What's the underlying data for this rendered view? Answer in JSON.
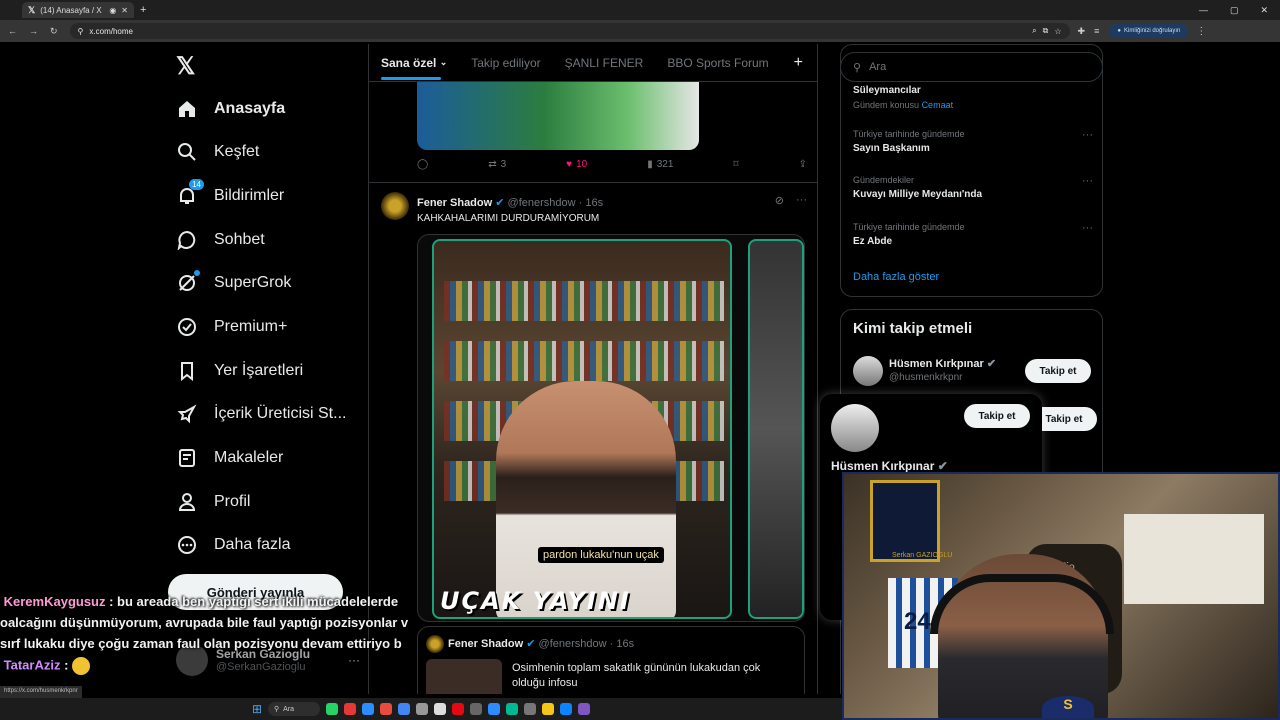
{
  "browser": {
    "tab_title": "(14) Anasayfa / X",
    "url": "x.com/home",
    "verify_label": "Kimliğinizi doğrulayın",
    "status_url": "https://x.com/husmenkrkpnr"
  },
  "sidebar": {
    "items": [
      {
        "label": "Anasayfa",
        "icon": "home-icon"
      },
      {
        "label": "Keşfet",
        "icon": "search-icon"
      },
      {
        "label": "Bildirimler",
        "icon": "bell-icon",
        "badge": "14"
      },
      {
        "label": "Sohbet",
        "icon": "chat-icon"
      },
      {
        "label": "SuperGrok",
        "icon": "grok-icon"
      },
      {
        "label": "Premium+",
        "icon": "verified-icon"
      },
      {
        "label": "Yer İşaretleri",
        "icon": "bookmark-icon"
      },
      {
        "label": "İçerik Üreticisi St...",
        "icon": "rocket-icon"
      },
      {
        "label": "Makaleler",
        "icon": "article-icon"
      },
      {
        "label": "Profil",
        "icon": "person-icon"
      },
      {
        "label": "Daha fazla",
        "icon": "more-icon"
      }
    ],
    "post_button": "Gönderi yayınla",
    "account": {
      "name": "Serkan Gazioglu",
      "handle": "@SerkanGazioglu"
    }
  },
  "main": {
    "tabs": [
      "Sana özel",
      "Takip ediliyor",
      "ŞANLI FENER",
      "BBO Sports Forum"
    ],
    "prev_tweet_actions": {
      "retweets": "3",
      "likes": "10",
      "views": "321"
    },
    "tweet": {
      "name": "Fener Shadow",
      "handle": "@fenershdow",
      "time": "16s",
      "text": "KAHKAHALARIMI DURDURAMİYORUM",
      "video_caption": "pardon lukaku'nun uçak",
      "video_overlay": "UÇAK YAYINI"
    },
    "quote": {
      "name": "Fener Shadow",
      "handle": "@fenershdow",
      "time": "16s",
      "text": "Osimhenin toplam sakatlık gününün lukakudan çok olduğu infosu"
    }
  },
  "right": {
    "search_placeholder": "Ara",
    "trends": [
      {
        "context": "Gündem konusu",
        "context_extra": "Cemaat",
        "name": "Süleymancılar"
      },
      {
        "context": "Türkiye tarihinde gündemde",
        "name": "Sayın Başkanım"
      },
      {
        "context": "Gündemdekiler",
        "name": "Kuvayı Milliye Meydanı'nda"
      },
      {
        "context": "Türkiye tarihinde gündemde",
        "name": "Ez Abde"
      }
    ],
    "show_more": "Daha fazla göster",
    "who_to_follow": {
      "title": "Kimi takip etmeli",
      "user": {
        "name": "Hüsmen Kırkpınar",
        "handle": "@husmenkrkpnr"
      },
      "follow_label": "Takip et"
    }
  },
  "hovercard": {
    "name": "Hüsmen Kırkpınar",
    "follow_label": "Takip et"
  },
  "webcam": {
    "jersey_number": "24",
    "nameplate": "Serkan GAZIOGLU",
    "chair_brand": "Zio"
  },
  "chat": [
    {
      "user": "KeremKaygusuz",
      "text": " : bu areada ben yaptığı sert ikili mücadelelerde"
    },
    {
      "user": "",
      "text": "oalcağını düşünmüyorum, avrupada bile faul yaptığı pozisyonlar v"
    },
    {
      "user": "",
      "text": "sırf lukaku diye çoğu zaman faul olan pozisyonu devam ettiriyo b"
    },
    {
      "user": "TatarAziz",
      "text": " : "
    }
  ],
  "taskbar": {
    "search_label": "Ara"
  }
}
